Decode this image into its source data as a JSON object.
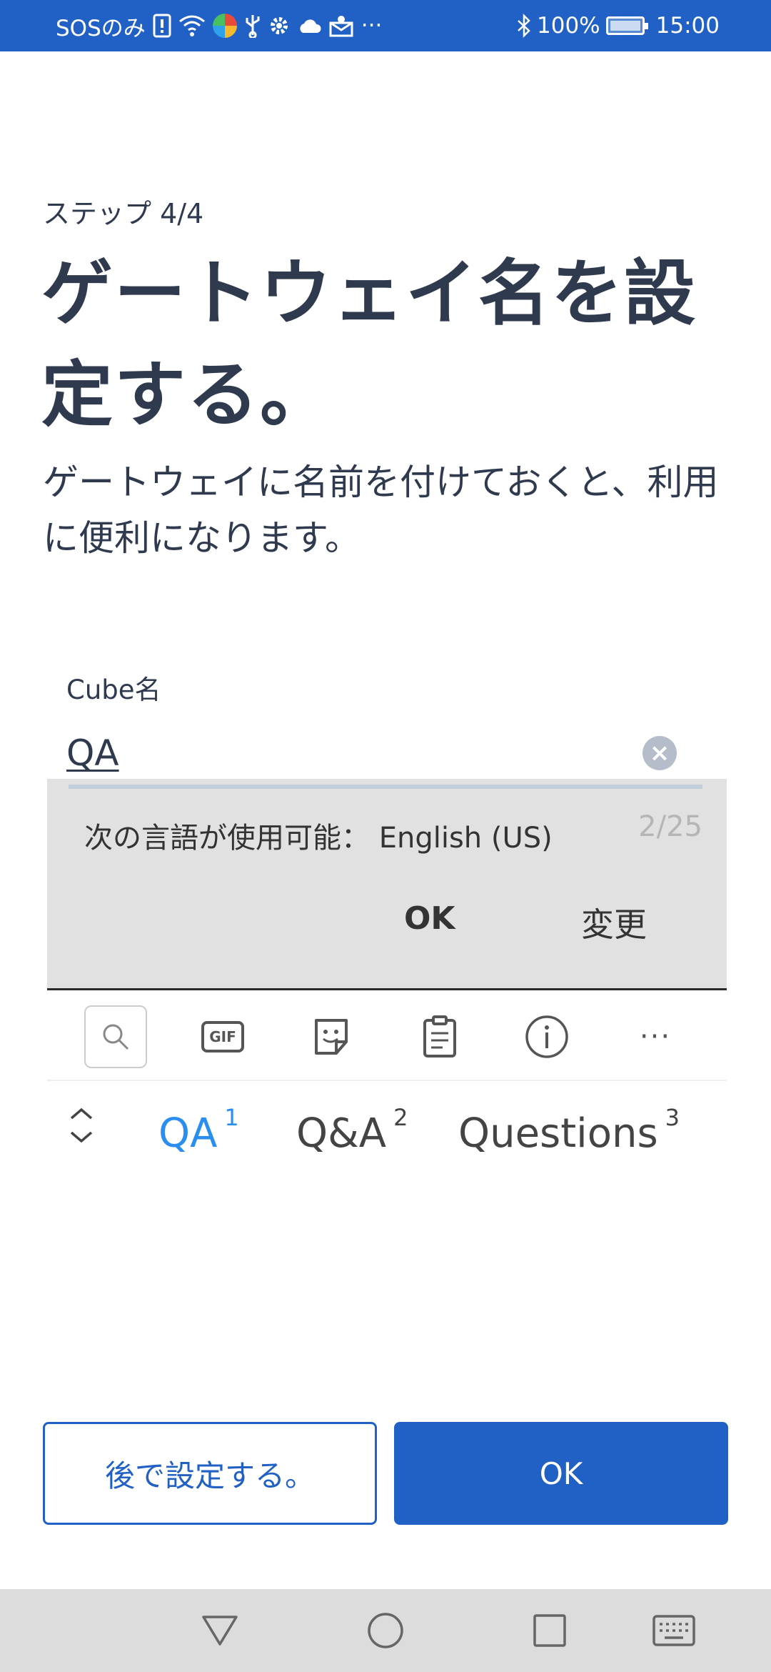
{
  "status_bar": {
    "carrier": "SOSのみ",
    "more": "···",
    "battery_percent": "100%",
    "time": "15:00",
    "icons": [
      "sim-alert-icon",
      "wifi-icon",
      "chrome-icon",
      "usb-icon",
      "gear-icon",
      "cloud-icon",
      "mail-icon",
      "bluetooth-icon",
      "battery-icon"
    ]
  },
  "header": {
    "step": "ステップ 4/4",
    "title": "ゲートウェイ名を設定する。",
    "description": "ゲートウェイに名前を付けておくと、利用に便利になります。"
  },
  "field": {
    "label": "Cube名",
    "value": "QA"
  },
  "language_panel": {
    "message": "次の言語が使用可能： English (US)",
    "counter": "2/25",
    "ok_label": "OK",
    "change_label": "変更"
  },
  "keyboard_toolbar": {
    "gif_label": "GIF",
    "more_label": "···"
  },
  "suggestions": [
    {
      "text": "QA",
      "index": "1"
    },
    {
      "text": "Q&A",
      "index": "2"
    },
    {
      "text": "Questions",
      "index": "3"
    }
  ],
  "actions": {
    "later_label": "後で設定する。",
    "ok_label": "OK"
  },
  "colors": {
    "brand_blue": "#2160c4",
    "suggestion_active": "#2a8ef0",
    "text_dark": "#2f3a4e"
  }
}
